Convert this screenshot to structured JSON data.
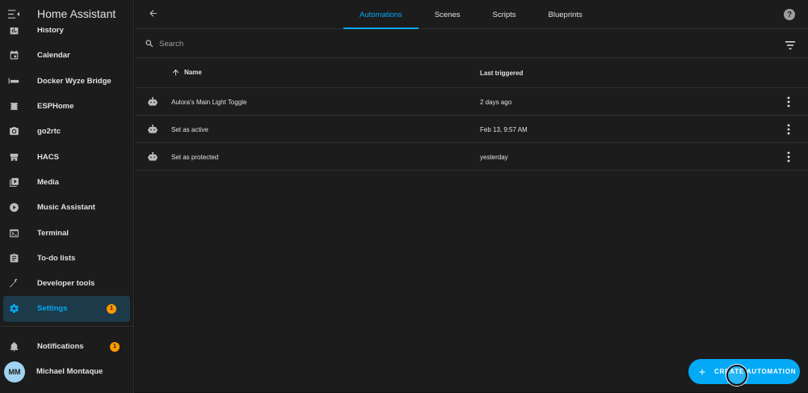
{
  "sidebar": {
    "title": "Home Assistant",
    "items": [
      {
        "label": "History",
        "icon": "chart-box-icon"
      },
      {
        "label": "Calendar",
        "icon": "calendar-icon"
      },
      {
        "label": "Docker Wyze Bridge",
        "icon": "cctv-icon"
      },
      {
        "label": "ESPHome",
        "icon": "chip-icon"
      },
      {
        "label": "go2rtc",
        "icon": "camera-icon"
      },
      {
        "label": "HACS",
        "icon": "store-icon"
      },
      {
        "label": "Media",
        "icon": "play-box-icon"
      },
      {
        "label": "Music Assistant",
        "icon": "play-circle-icon"
      },
      {
        "label": "Terminal",
        "icon": "console-icon"
      },
      {
        "label": "To-do lists",
        "icon": "clipboard-list-icon"
      },
      {
        "label": "Developer tools",
        "icon": "hammer-icon"
      },
      {
        "label": "Settings",
        "icon": "gear-icon",
        "badge": "1",
        "active": true
      }
    ],
    "notifications": {
      "label": "Notifications",
      "badge": "1"
    },
    "user": {
      "initials": "MM",
      "name": "Michael Montaque"
    }
  },
  "header": {
    "tabs": [
      {
        "label": "Automations",
        "active": true
      },
      {
        "label": "Scenes"
      },
      {
        "label": "Scripts"
      },
      {
        "label": "Blueprints"
      }
    ]
  },
  "search": {
    "placeholder": "Search"
  },
  "table": {
    "columns": {
      "name": "Name",
      "last_triggered": "Last triggered"
    },
    "rows": [
      {
        "name": "Aulora's Main Light Toggle",
        "last_triggered": "2 days ago"
      },
      {
        "name": "Set as active",
        "last_triggered": "Feb 13, 9:57 AM"
      },
      {
        "name": "Set as protected",
        "last_triggered": "yesterday"
      }
    ]
  },
  "fab": {
    "label": "CREATE AUTOMATION"
  },
  "colors": {
    "accent": "#03a9f4",
    "badge": "#ff9800",
    "background": "#111111",
    "surface": "#1c1c1c"
  }
}
